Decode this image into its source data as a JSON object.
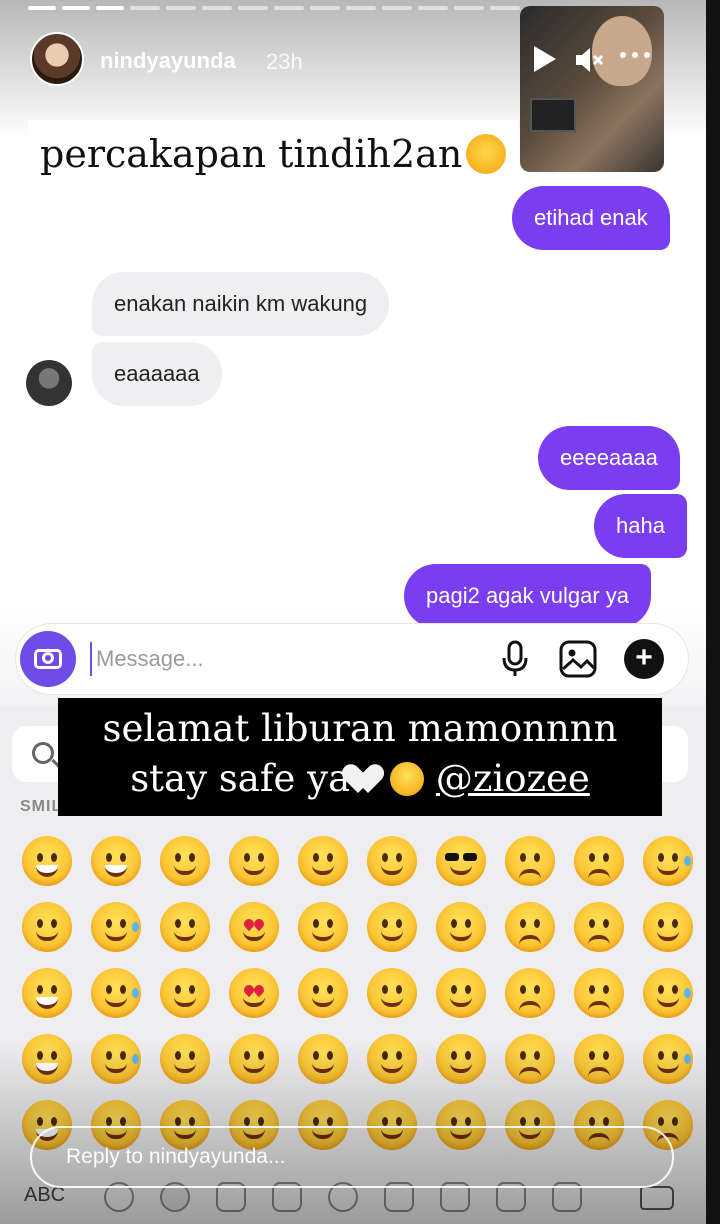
{
  "story": {
    "username": "nindyayunda",
    "time_ago": "23h",
    "progress_segments": 15,
    "controls": {
      "play": "play-icon",
      "mute": "muted-speaker-icon",
      "more": "more-dots-icon"
    }
  },
  "stickers": {
    "top_text": "percakapan tindih2an",
    "main_line1": "selamat liburan mamonnnn",
    "main_line2": "stay safe ya",
    "mention": "@ziozee"
  },
  "chat": {
    "messages": [
      {
        "side": "out",
        "text": "etihad enak"
      },
      {
        "side": "in",
        "text": "enakan naikin km wakung"
      },
      {
        "side": "in",
        "text": "eaaaaaa"
      },
      {
        "side": "out",
        "text": "eeeeaaaa"
      },
      {
        "side": "out",
        "text": "haha"
      },
      {
        "side": "out",
        "text": "pagi2 agak vulgar ya"
      }
    ]
  },
  "composer": {
    "placeholder": "Message...",
    "icons": [
      "camera-icon",
      "microphone-icon",
      "gallery-icon",
      "plus-icon"
    ]
  },
  "keyboard": {
    "category_label": "SMILEYS & PEOPLE",
    "abc_label": "ABC",
    "accent": "#6f4be8"
  },
  "reply": {
    "placeholder": "Reply to nindyayunda..."
  },
  "colors": {
    "outgoing_bubble": "#7a3df0",
    "incoming_bubble": "#efeff1"
  }
}
